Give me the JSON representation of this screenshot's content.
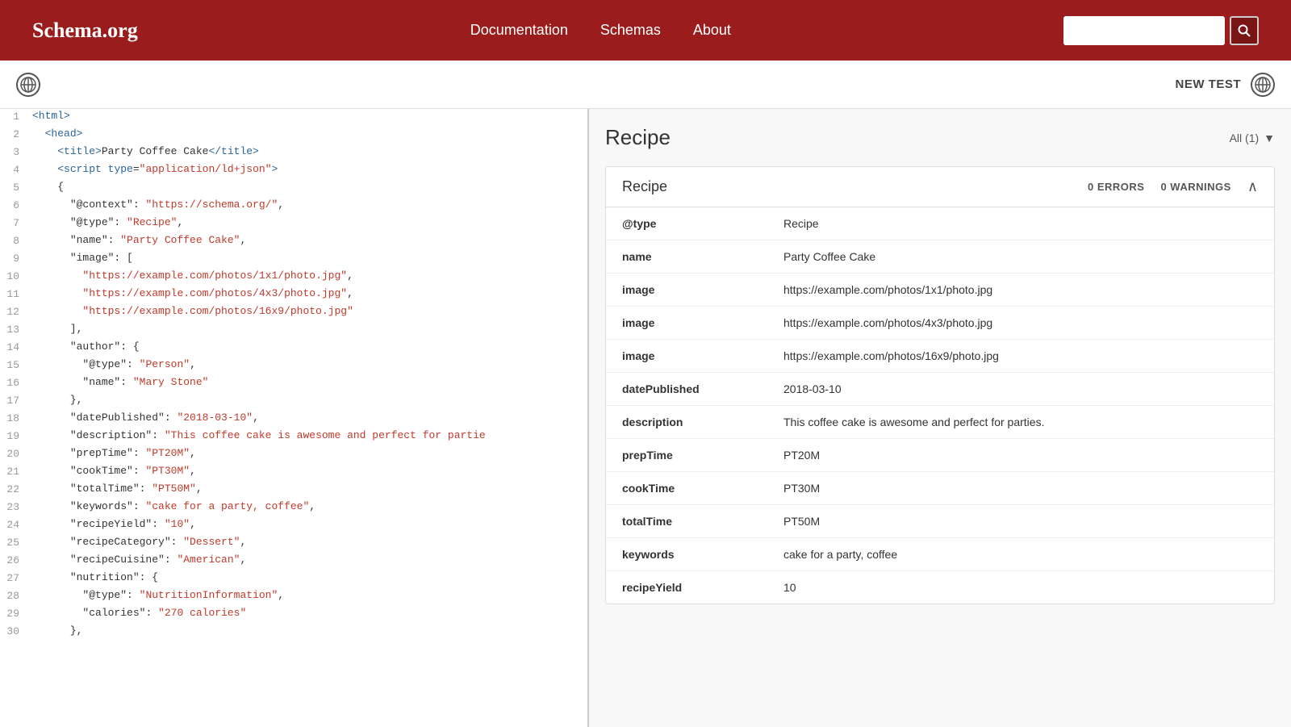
{
  "header": {
    "logo": "Schema.org",
    "nav": [
      {
        "label": "Documentation",
        "id": "documentation"
      },
      {
        "label": "Schemas",
        "id": "schemas"
      },
      {
        "label": "About",
        "id": "about"
      }
    ],
    "search_placeholder": "",
    "search_button_icon": "🔍"
  },
  "toolbar": {
    "new_test_label": "NEW TEST",
    "globe_icon": "🌐"
  },
  "code_panel": {
    "lines": [
      {
        "num": 1,
        "html": "<span class='tag'>&lt;html&gt;</span>"
      },
      {
        "num": 2,
        "html": "  <span class='tag'>&lt;head&gt;</span>"
      },
      {
        "num": 3,
        "html": "    <span class='tag'>&lt;title&gt;</span>Party Coffee Cake<span class='tag'>&lt;/title&gt;</span>"
      },
      {
        "num": 4,
        "html": "    <span class='tag'>&lt;script</span> <span class='attr-name'>type</span>=<span class='attr-val'>\"application/ld+json\"</span><span class='tag'>&gt;</span>"
      },
      {
        "num": 5,
        "html": "    {"
      },
      {
        "num": 6,
        "html": "      <span class='key'>\"@context\"</span>: <span class='str-val'>\"https://schema.org/\"</span>,"
      },
      {
        "num": 7,
        "html": "      <span class='key'>\"@type\"</span>: <span class='str-val'>\"Recipe\"</span>,"
      },
      {
        "num": 8,
        "html": "      <span class='key'>\"name\"</span>: <span class='str-val'>\"Party Coffee Cake\"</span>,"
      },
      {
        "num": 9,
        "html": "      <span class='key'>\"image\"</span>: ["
      },
      {
        "num": 10,
        "html": "        <span class='str-val'>\"https://example.com/photos/1x1/photo.jpg\"</span>,"
      },
      {
        "num": 11,
        "html": "        <span class='str-val'>\"https://example.com/photos/4x3/photo.jpg\"</span>,"
      },
      {
        "num": 12,
        "html": "        <span class='str-val'>\"https://example.com/photos/16x9/photo.jpg\"</span>"
      },
      {
        "num": 13,
        "html": "      ],"
      },
      {
        "num": 14,
        "html": "      <span class='key'>\"author\"</span>: {"
      },
      {
        "num": 15,
        "html": "        <span class='key'>\"@type\"</span>: <span class='str-val'>\"Person\"</span>,"
      },
      {
        "num": 16,
        "html": "        <span class='key'>\"name\"</span>: <span class='str-val'>\"Mary Stone\"</span>"
      },
      {
        "num": 17,
        "html": "      },"
      },
      {
        "num": 18,
        "html": "      <span class='key'>\"datePublished\"</span>: <span class='str-val'>\"2018-03-10\"</span>,"
      },
      {
        "num": 19,
        "html": "      <span class='key'>\"description\"</span>: <span class='str-val'>\"This coffee cake is awesome and perfect for partie</span>"
      },
      {
        "num": 20,
        "html": "      <span class='key'>\"prepTime\"</span>: <span class='str-val'>\"PT20M\"</span>,"
      },
      {
        "num": 21,
        "html": "      <span class='key'>\"cookTime\"</span>: <span class='str-val'>\"PT30M\"</span>,"
      },
      {
        "num": 22,
        "html": "      <span class='key'>\"totalTime\"</span>: <span class='str-val'>\"PT50M\"</span>,"
      },
      {
        "num": 23,
        "html": "      <span class='key'>\"keywords\"</span>: <span class='str-val'>\"cake for a party, coffee\"</span>,"
      },
      {
        "num": 24,
        "html": "      <span class='key'>\"recipeYield\"</span>: <span class='str-val'>\"10\"</span>,"
      },
      {
        "num": 25,
        "html": "      <span class='key'>\"recipeCategory\"</span>: <span class='str-val'>\"Dessert\"</span>,"
      },
      {
        "num": 26,
        "html": "      <span class='key'>\"recipeCuisine\"</span>: <span class='str-val'>\"American\"</span>,"
      },
      {
        "num": 27,
        "html": "      <span class='key'>\"nutrition\"</span>: {"
      },
      {
        "num": 28,
        "html": "        <span class='key'>\"@type\"</span>: <span class='str-val'>\"NutritionInformation\"</span>,"
      },
      {
        "num": 29,
        "html": "        <span class='key'>\"calories\"</span>: <span class='str-val'>\"270 calories\"</span>"
      },
      {
        "num": 30,
        "html": "      },"
      }
    ]
  },
  "results_panel": {
    "title": "Recipe",
    "filter_label": "All (1)",
    "card": {
      "title": "Recipe",
      "errors_label": "0 ERRORS",
      "warnings_label": "0 WARNINGS",
      "rows": [
        {
          "key": "@type",
          "value": "Recipe"
        },
        {
          "key": "name",
          "value": "Party Coffee Cake"
        },
        {
          "key": "image",
          "value": "https://example.com/photos/1x1/photo.jpg"
        },
        {
          "key": "image",
          "value": "https://example.com/photos/4x3/photo.jpg"
        },
        {
          "key": "image",
          "value": "https://example.com/photos/16x9/photo.jpg"
        },
        {
          "key": "datePublished",
          "value": "2018-03-10"
        },
        {
          "key": "description",
          "value": "This coffee cake is awesome and perfect for parties."
        },
        {
          "key": "prepTime",
          "value": "PT20M"
        },
        {
          "key": "cookTime",
          "value": "PT30M"
        },
        {
          "key": "totalTime",
          "value": "PT50M"
        },
        {
          "key": "keywords",
          "value": "cake for a party, coffee"
        },
        {
          "key": "recipeYield",
          "value": "10"
        }
      ]
    }
  }
}
